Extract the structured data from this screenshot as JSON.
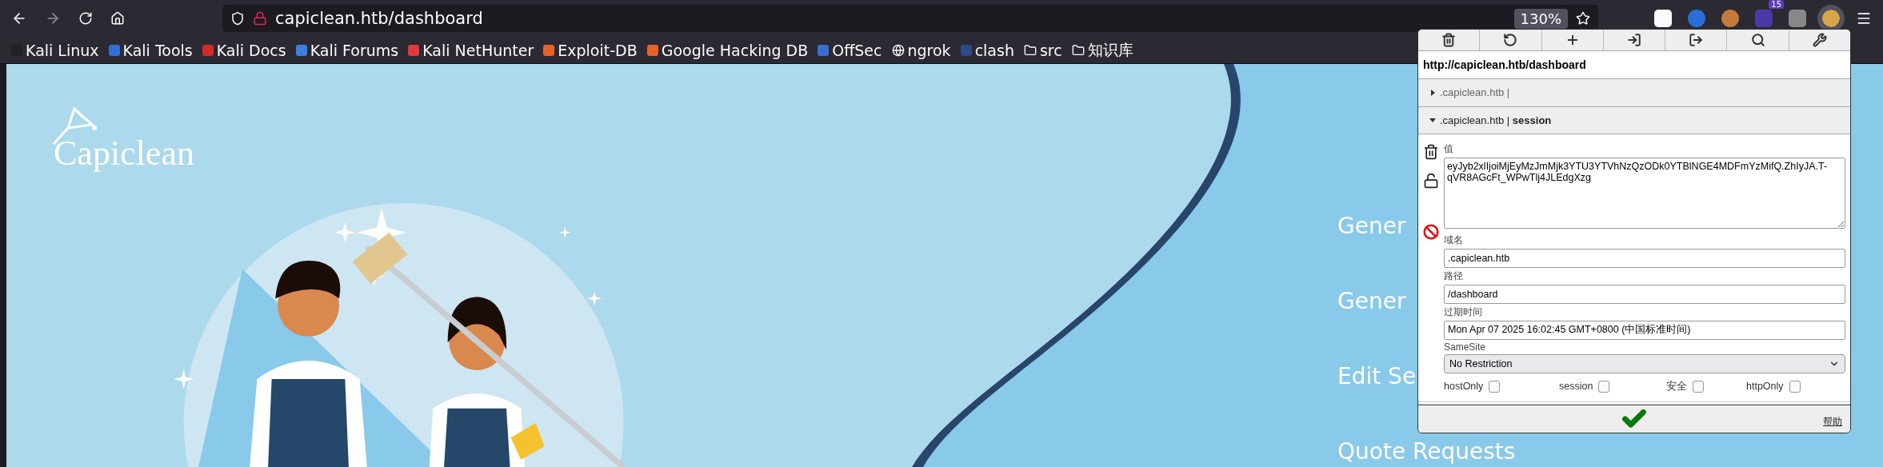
{
  "browser": {
    "url": "capiclean.htb/dashboard",
    "zoom": "130%",
    "extension_badge": "15"
  },
  "bookmarks": [
    {
      "label": "Kali Linux",
      "kind": "site",
      "color": "#222222"
    },
    {
      "label": "Kali Tools",
      "kind": "site",
      "color": "#2f6fd6"
    },
    {
      "label": "Kali Docs",
      "kind": "site",
      "color": "#d42a2a"
    },
    {
      "label": "Kali Forums",
      "kind": "site",
      "color": "#3b7fe0"
    },
    {
      "label": "Kali NetHunter",
      "kind": "site",
      "color": "#e03a3a"
    },
    {
      "label": "Exploit-DB",
      "kind": "site",
      "color": "#e8632a"
    },
    {
      "label": "Google Hacking DB",
      "kind": "site",
      "color": "#e8632a"
    },
    {
      "label": "OffSec",
      "kind": "site",
      "color": "#3a6fd0"
    },
    {
      "label": "ngrok",
      "kind": "globe"
    },
    {
      "label": "clash",
      "kind": "site",
      "color": "#2a4a8a"
    },
    {
      "label": "src",
      "kind": "folder"
    },
    {
      "label": "知识库",
      "kind": "folder"
    }
  ],
  "page": {
    "logo": "Capiclean",
    "menu": [
      "Gener",
      "Gener",
      "Edit Se",
      "Quote Requests"
    ]
  },
  "cookie_editor": {
    "url": "http://capiclean.htb/dashboard",
    "cookies": [
      {
        "domain": ".capiclean.htb |",
        "expanded": false
      },
      {
        "domain": ".capiclean.htb |",
        "name": "session",
        "expanded": true
      }
    ],
    "value_label": "值",
    "value": "eyJyb2xlIjoiMjEyMzJmMjk3YTU3YTVhNzQzODk0YTBlNGE4MDFmYzMifQ.ZhIyJA.T-qVR8AGcFt_WPwTlj4JLEdgXzg",
    "domain_label": "域名",
    "domain": ".capiclean.htb",
    "path_label": "路径",
    "path": "/dashboard",
    "expires_label": "过期时间",
    "expires": "Mon Apr 07 2025 16:02:45 GMT+0800 (中国标准时间)",
    "samesite_label": "SameSite",
    "samesite": "No Restriction",
    "flags": [
      {
        "label": "hostOnly",
        "checked": false
      },
      {
        "label": "session",
        "checked": false
      },
      {
        "label": "安全",
        "checked": false
      },
      {
        "label": "httpOnly",
        "checked": false
      }
    ],
    "help": "帮助"
  }
}
